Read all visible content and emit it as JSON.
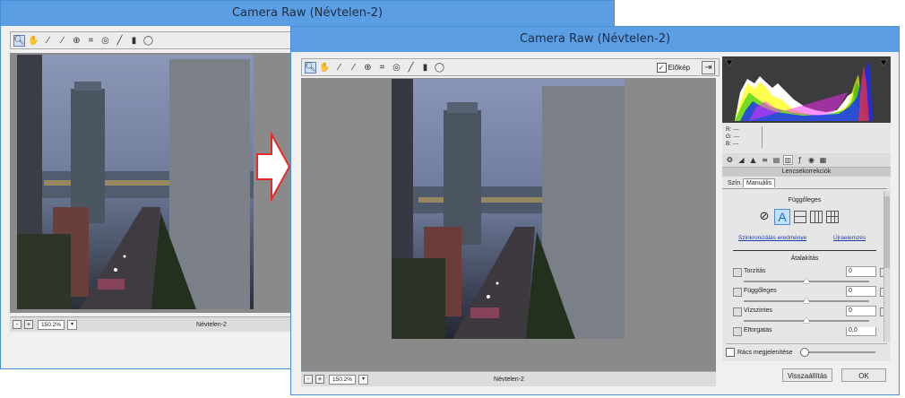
{
  "back_window": {
    "title": "Camera Raw (Névtelen-2)",
    "zoom": "150.2%",
    "filename": "Névtelen-2",
    "minus": "-",
    "plus": "+",
    "dropdown": "▾"
  },
  "front_window": {
    "title": "Camera Raw (Névtelen-2)",
    "preview_label": "Előkép",
    "zoom": "150.2%",
    "filename": "Névtelen-2",
    "minus": "-",
    "plus": "+",
    "dropdown": "▾",
    "rgb": {
      "r": "R:  ---",
      "g": "G:  ---",
      "b": "B:  ---"
    },
    "section_title": "Lencsekorrekciók",
    "tabs": [
      "Szín",
      "Manuális"
    ],
    "vertical_heading": "Függőleges",
    "sync_link": "Szinkronizálás eredménye",
    "reanalyze_link": "Újraelemzés",
    "transform_heading": "Átalakítás",
    "sliders": [
      {
        "label": "Torzítás",
        "value": "0",
        "level": 0.5
      },
      {
        "label": "Függőleges",
        "value": "0",
        "level": 0.5
      },
      {
        "label": "Vízszintes",
        "value": "0",
        "level": 0.5
      },
      {
        "label": "Elforgatás",
        "value": "0,0",
        "level": 0.5
      }
    ],
    "grid_label": "Rács megjelenítése",
    "reset_button": "Visszaállítás",
    "ok_button": "OK",
    "upright_letter": "A"
  },
  "colors": {
    "titlebar": "#5b9ee3",
    "arrow": "#e52a2a",
    "histogram_bg": "#3c3c3c"
  },
  "icons": [
    "zoom-icon",
    "hand-icon",
    "eyedropper-icon",
    "color-sampler-icon",
    "targeted-adjust-icon",
    "crop-icon",
    "straighten-icon",
    "red-eye-icon",
    "brush-icon",
    "filter-icon",
    "rotate-icon",
    "fullscreen-icon"
  ]
}
